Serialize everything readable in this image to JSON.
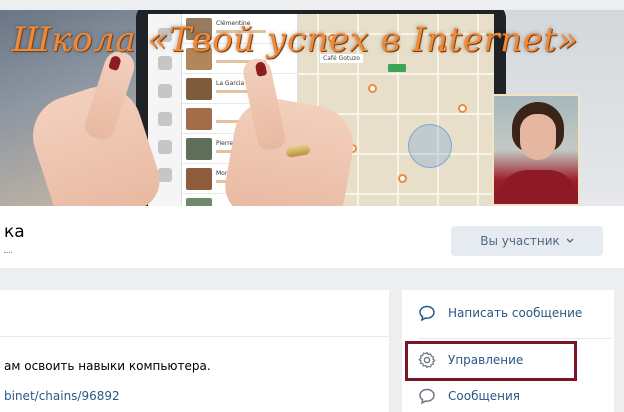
{
  "cover": {
    "title": "Школа «Твой успех в Internet»",
    "colors": {
      "title": "#f08a3b",
      "highlight_border": "#7b1424",
      "link": "#2a5885"
    },
    "app_items": [
      "Clémentine",
      "",
      "La Garcia",
      "",
      "Pierre",
      "Mori Venice",
      ""
    ],
    "map_label": "Café Gotuzo"
  },
  "header": {
    "group_name": "ка",
    "member_button": "Вы участник",
    "member_chevron": "chevron-down-icon"
  },
  "post": {
    "text": "ам освоить навыки компьютера.",
    "link": "binet/chains/96892"
  },
  "actions": [
    {
      "label": "Написать сообщение",
      "icon": "message-icon"
    },
    {
      "label": "Управление",
      "icon": "gear-icon"
    },
    {
      "label": "Сообщения",
      "icon": "message-icon"
    }
  ]
}
